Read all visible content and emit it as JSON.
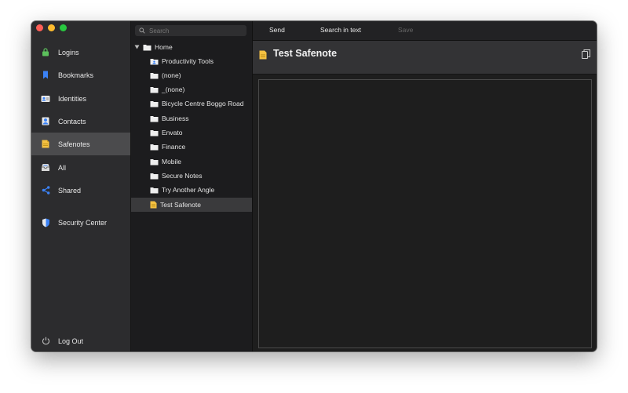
{
  "sidebar": {
    "items": [
      {
        "label": "Logins",
        "icon": "lock-icon"
      },
      {
        "label": "Bookmarks",
        "icon": "bookmark-icon"
      },
      {
        "label": "Identities",
        "icon": "id-card-icon"
      },
      {
        "label": "Contacts",
        "icon": "contact-icon"
      },
      {
        "label": "Safenotes",
        "icon": "note-icon"
      },
      {
        "label": "All",
        "icon": "inbox-icon"
      },
      {
        "label": "Shared",
        "icon": "share-icon"
      },
      {
        "label": "Security Center",
        "icon": "shield-icon"
      }
    ],
    "active": "Safenotes",
    "logout_label": "Log Out"
  },
  "search": {
    "placeholder": "Search"
  },
  "tree": {
    "root_label": "Home",
    "items": [
      {
        "label": "Productivity Tools",
        "type": "shared-folder"
      },
      {
        "label": "(none)",
        "type": "folder"
      },
      {
        "label": "_(none)",
        "type": "folder"
      },
      {
        "label": "Bicycle Centre Boggo Road",
        "type": "folder"
      },
      {
        "label": "Business",
        "type": "folder"
      },
      {
        "label": "Envato",
        "type": "folder"
      },
      {
        "label": "Finance",
        "type": "folder"
      },
      {
        "label": "Mobile",
        "type": "folder"
      },
      {
        "label": "Secure Notes",
        "type": "folder"
      },
      {
        "label": "Try Another Angle",
        "type": "folder"
      },
      {
        "label": "Test Safenote",
        "type": "note"
      }
    ],
    "selected": "Test Safenote"
  },
  "toolbar": {
    "send_label": "Send",
    "search_text_label": "Search in text",
    "save_label": "Save"
  },
  "note": {
    "title": "Test Safenote",
    "content": ""
  },
  "colors": {
    "note_yellow": "#f5c242",
    "accent_blue": "#3b82f6",
    "lock_green": "#5cc05c"
  }
}
